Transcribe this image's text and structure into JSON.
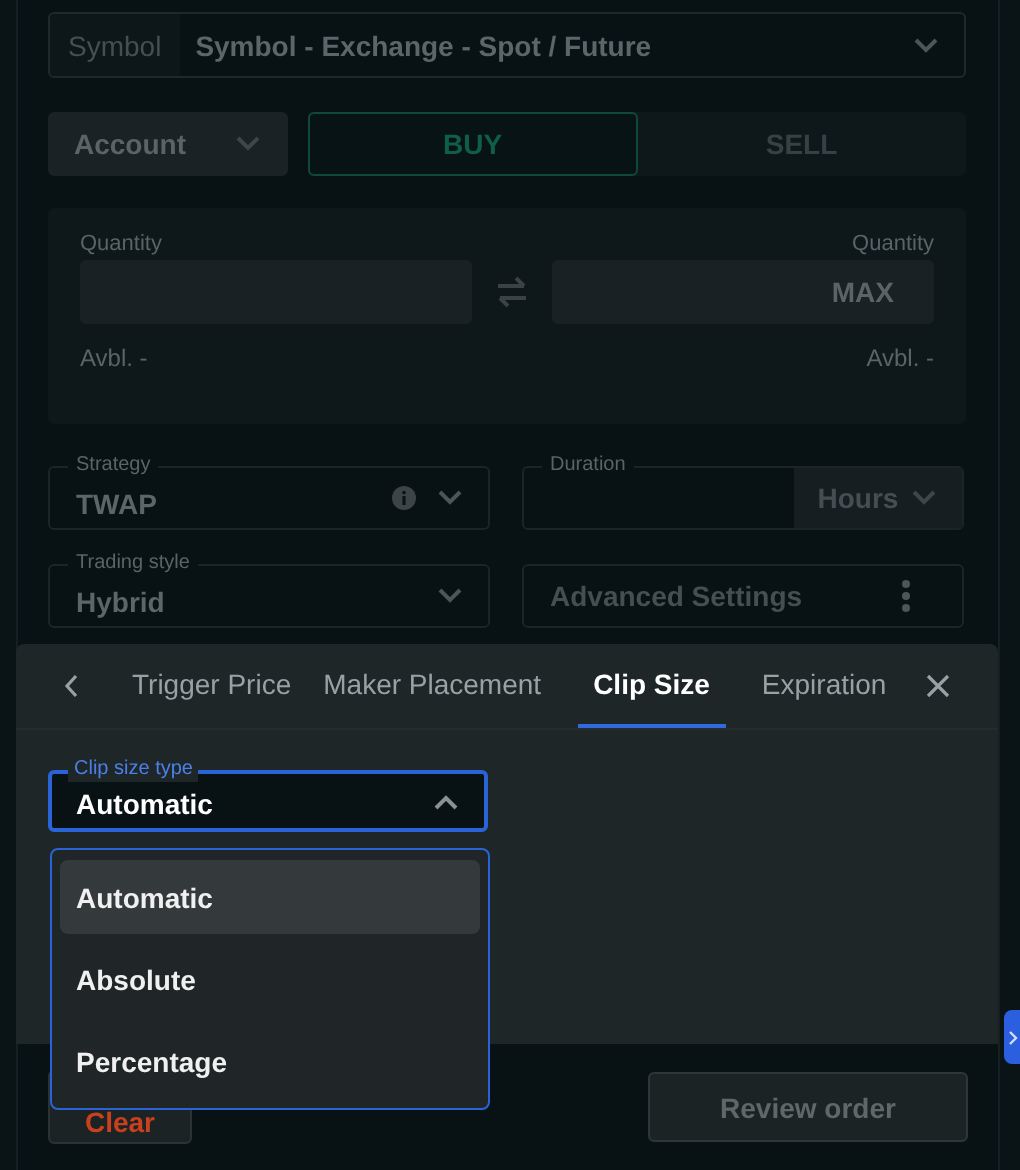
{
  "symbol": {
    "label": "Symbol",
    "value": "Symbol - Exchange - Spot / Future"
  },
  "account": {
    "value": "Account"
  },
  "sides": [
    {
      "label": "BUY",
      "selected": true
    },
    {
      "label": "SELL",
      "selected": false
    }
  ],
  "quantity": {
    "left_label": "Quantity",
    "right_label": "Quantity",
    "max_button": "MAX",
    "left_available": "Avbl. -",
    "right_available": "Avbl. -"
  },
  "strategy": {
    "label": "Strategy",
    "value": "TWAP"
  },
  "duration": {
    "label": "Duration",
    "unit": "Hours"
  },
  "trading_style": {
    "label": "Trading style",
    "value": "Hybrid"
  },
  "advanced_settings": "Advanced Settings",
  "sheet": {
    "tabs": [
      {
        "label": "Trigger Price",
        "selected": false
      },
      {
        "label": "Maker Placement",
        "selected": false
      },
      {
        "label": "Clip Size",
        "selected": true
      },
      {
        "label": "Expiration",
        "selected": false
      }
    ],
    "clip_size_type": {
      "label": "Clip size type",
      "value": "Automatic",
      "expanded": true
    },
    "options": [
      {
        "label": "Automatic",
        "selected": true
      },
      {
        "label": "Absolute",
        "selected": false
      },
      {
        "label": "Percentage",
        "selected": false
      }
    ]
  },
  "footer": {
    "clear": "Clear",
    "review": "Review order"
  }
}
